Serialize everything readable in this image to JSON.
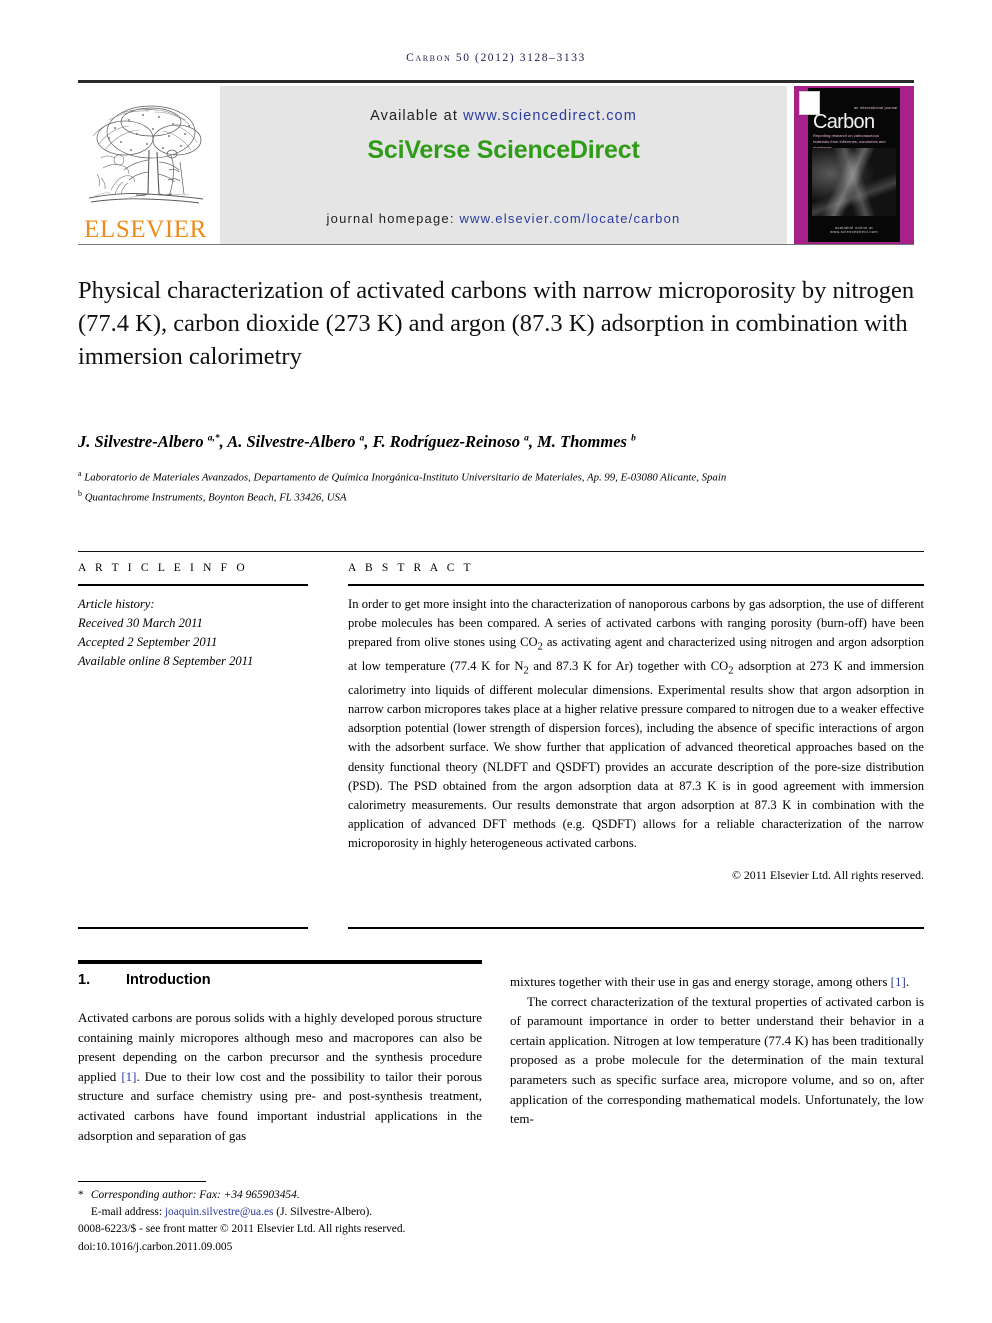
{
  "running_head": "Carbon 50 (2012) 3128–3133",
  "masthead": {
    "publisher_name": "ELSEVIER",
    "available_prefix": "Available at ",
    "available_url": "www.sciencedirect.com",
    "platform": "SciVerse ScienceDirect",
    "homepage_prefix": "journal homepage: ",
    "homepage_url": "www.elsevier.com/locate/carbon",
    "cover": {
      "journal_name": "Carbon",
      "tagline": "an international journal",
      "subtitle": "Reporting research on carbonaceous materials from fullerenes, nanotubes and graphenes",
      "footer": "available online at www.sciencedirect.com"
    }
  },
  "article": {
    "title": "Physical characterization of activated carbons with narrow microporosity by nitrogen (77.4 K), carbon dioxide (273 K) and argon (87.3 K) adsorption in combination with immersion calorimetry",
    "authors_html": "J. Silvestre-Albero <sup>a,*</sup>, A. Silvestre-Albero <sup>a</sup>, F. Rodríguez-Reinoso <sup>a</sup>, M. Thommes <sup>b</sup>",
    "affiliation_a": "Laboratorio de Materiales Avanzados, Departamento de Química Inorgánica-Instituto Universitario de Materiales, Ap. 99, E-03080 Alicante, Spain",
    "affiliation_b": "Quantachrome Instruments, Boynton Beach, FL 33426, USA"
  },
  "article_info": {
    "heading": "A R T I C L E   I N F O",
    "history_label": "Article history:",
    "received": "Received 30 March 2011",
    "accepted": "Accepted 2 September 2011",
    "available_online": "Available online 8 September 2011"
  },
  "abstract": {
    "heading": "A B S T R A C T",
    "text": "In order to get more insight into the characterization of nanoporous carbons by gas adsorption, the use of different probe molecules has been compared. A series of activated carbons with ranging porosity (burn-off) have been prepared from olive stones using CO2 as activating agent and characterized using nitrogen and argon adsorption at low temperature (77.4 K for N2 and 87.3 K for Ar) together with CO2 adsorption at 273 K and immersion calorimetry into liquids of different molecular dimensions. Experimental results show that argon adsorption in narrow carbon micropores takes place at a higher relative pressure compared to nitrogen due to a weaker effective adsorption potential (lower strength of dispersion forces), including the absence of specific interactions of argon with the adsorbent surface. We show further that application of advanced theoretical approaches based on the density functional theory (NLDFT and QSDFT) provides an accurate description of the pore-size distribution (PSD). The PSD obtained from the argon adsorption data at 87.3 K is in good agreement with immersion calorimetry measurements. Our results demonstrate that argon adsorption at 87.3 K in combination with the application of advanced DFT methods (e.g. QSDFT) allows for a reliable characterization of the narrow microporosity in highly heterogeneous activated carbons.",
    "copyright": "© 2011 Elsevier Ltd. All rights reserved."
  },
  "body": {
    "section_number": "1.",
    "section_title": "Introduction",
    "left_paragraph_1": "Activated carbons are porous solids with a highly developed porous structure containing mainly micropores although meso and macropores can also be present depending on the carbon precursor and the synthesis procedure applied ",
    "left_ref_1": "[1]",
    "left_paragraph_1b": ". Due to their low cost and the possibility to tailor their porous structure and surface chemistry using pre- and post-synthesis treatment, activated carbons have found important industrial applications in the adsorption and separation of gas",
    "right_paragraph_1a": "mixtures together with their use in gas and energy storage, among others ",
    "right_ref_1": "[1]",
    "right_paragraph_1b": ".",
    "right_paragraph_2": "The correct characterization of the textural properties of activated carbon is of paramount importance in order to better understand their behavior in a certain application. Nitrogen at low temperature (77.4 K) has been traditionally proposed as a probe molecule for the determination of the main textural parameters such as specific surface area, micropore volume, and so on, after application of the corresponding mathematical models. Unfortunately, the low tem-"
  },
  "footnote": {
    "corresponding": "Corresponding author: Fax: +34 965903454.",
    "email_label": "E-mail address: ",
    "email": "joaquin.silvestre@ua.es",
    "email_suffix": " (J. Silvestre-Albero).",
    "issn_line": "0008-6223/$ - see front matter © 2011 Elsevier Ltd. All rights reserved.",
    "doi_line": "doi:10.1016/j.carbon.2011.09.005"
  },
  "colors": {
    "link_blue": "#2a3b9e",
    "elsevier_orange": "#ec8c1c",
    "sciverse_green": "#2f9b17",
    "cover_magenta": "#a6218a"
  }
}
